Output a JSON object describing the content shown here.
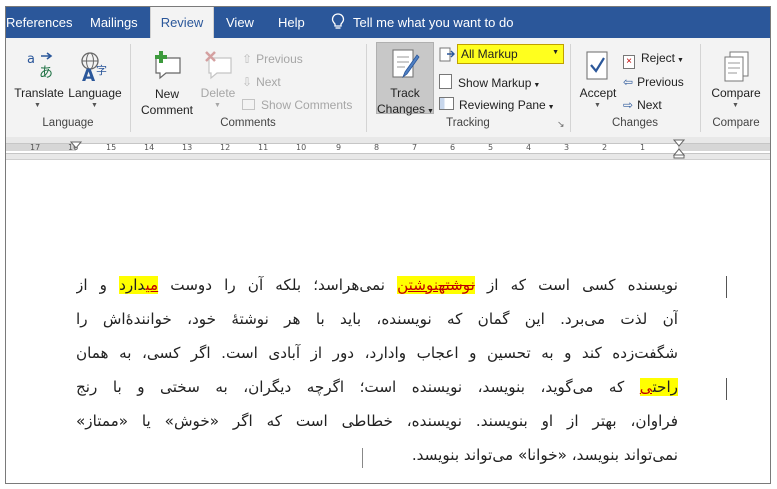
{
  "tabs": [
    "References",
    "Mailings",
    "Review",
    "View",
    "Help"
  ],
  "tell_me": "Tell me what you want to do",
  "ribbon": {
    "language_group": {
      "label": "Language",
      "translate": "Translate",
      "language": "Language"
    },
    "comments_group": {
      "label": "Comments",
      "new_comment_1": "New",
      "new_comment_2": "Comment",
      "delete": "Delete",
      "previous": "Previous",
      "next": "Next",
      "show_comments": "Show Comments"
    },
    "tracking_group": {
      "label": "Tracking",
      "track_changes_1": "Track",
      "track_changes_2": "Changes",
      "markup_select": "All Markup",
      "show_markup": "Show Markup",
      "reviewing_pane": "Reviewing Pane"
    },
    "changes_group": {
      "label": "Changes",
      "accept": "Accept",
      "reject": "Reject",
      "previous": "Previous",
      "next": "Next"
    },
    "compare_group": {
      "label": "Compare",
      "compare": "Compare"
    }
  },
  "ruler": {
    "numbers": [
      "17",
      "16",
      "15",
      "14",
      "13",
      "12",
      "11",
      "10",
      "9",
      "8",
      "7",
      "6",
      "5",
      "4",
      "3",
      "2",
      "1"
    ]
  },
  "document": {
    "l1a": "نویسنده کسی است که از ",
    "l1_del": "نوشته",
    "l1_ins": "نوشتن",
    "l1b": " نمی‌هراسد؛ بلکه آن را دوست ",
    "l1_ins2": "می",
    "l1c": "دارد",
    "l1d": " و از",
    "l2": "آن لذت می‌برد. این گمان که نویسنده، باید با هر نوشتهٔ خود، خوانندهٔ‌اش را",
    "l3": "شگفت‌زده کند و به تحسین و اعجاب وادارد، دور از آبادی است. اگر کسی، به همان",
    "l4a": "راحت",
    "l4_ins": "ی",
    "l4b": " که می‌گوید، بنویسد، نویسنده است؛ اگرچه دیگران، به سختی و با رنج",
    "l5": "فراوان، بهتر از او بنویسند. نویسنده، خطاطی است که اگر «خوش» یا «ممتاز»",
    "l6": "نمی‌تواند بنویسد، «خوانا» می‌تواند بنویسد."
  }
}
